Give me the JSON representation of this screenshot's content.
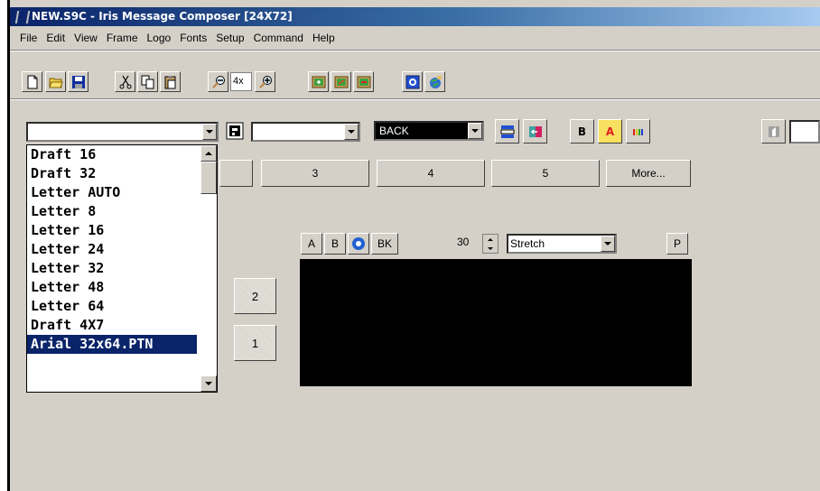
{
  "window": {
    "title": "NEW.S9C - Iris Message Composer  [24X72]"
  },
  "menubar": {
    "items": [
      "File",
      "Edit",
      "View",
      "Frame",
      "Logo",
      "Fonts",
      "Setup",
      "Command",
      "Help"
    ]
  },
  "toolbar": {
    "zoom_value": "4x"
  },
  "format_bar": {
    "color_combo_value": "BACK",
    "bold_label": "B",
    "font_color_label": "A"
  },
  "frame_tabs": {
    "labels": [
      "3",
      "4",
      "5",
      "More..."
    ]
  },
  "font_dropdown": {
    "options": [
      "Draft 16",
      "Draft 32",
      "Letter AUTO",
      "Letter 8",
      "Letter 16",
      "Letter 24",
      "Letter 32",
      "Letter 48",
      "Letter 64",
      "Draft 4X7",
      "Arial 32x64.PTN"
    ],
    "selected": "Arial 32x64.PTN"
  },
  "line_buttons": {
    "labels": [
      "2",
      "1"
    ]
  },
  "page_controls": {
    "page_a": "A",
    "page_b": "B",
    "bk": "BK",
    "time_value": "30",
    "mode_value": "Stretch",
    "p_label": "P"
  },
  "colors": {
    "title_bar": "#0a246a",
    "window_bg": "#d4d0c8",
    "selection": "#0a246a",
    "sign_bg": "#000000"
  }
}
